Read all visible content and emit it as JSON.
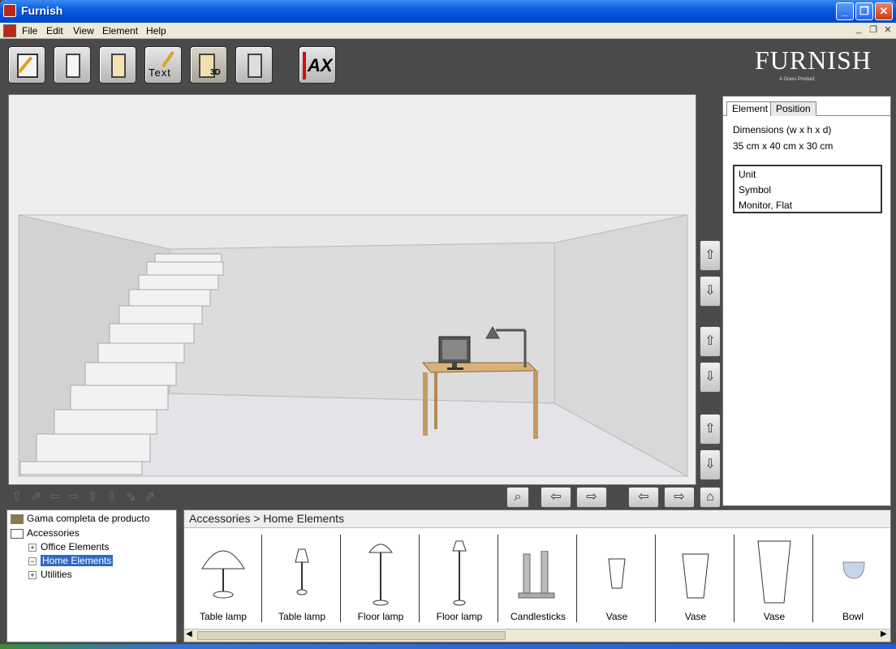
{
  "window": {
    "title": "Furnish"
  },
  "menu": {
    "items": [
      "File",
      "Edit",
      "View",
      "Element",
      "Help"
    ]
  },
  "toolbar": {
    "buttons": [
      {
        "name": "draw-tool",
        "label": ""
      },
      {
        "name": "door-tool",
        "label": ""
      },
      {
        "name": "window-tool",
        "label": ""
      },
      {
        "name": "text-tool",
        "label": "Text"
      },
      {
        "name": "3d-view",
        "label": "3D"
      },
      {
        "name": "calculator",
        "label": ""
      },
      {
        "name": "ax-button",
        "label": "AX"
      }
    ]
  },
  "brand": {
    "logo": "FURNISH",
    "sub": "A Grass Product"
  },
  "properties": {
    "tabs": [
      "Element",
      "Position"
    ],
    "dimensions_label": "Dimensions (w x h x d)",
    "dimensions_value": "35 cm x 40 cm x 30 cm",
    "attributes": [
      "Unit",
      "Symbol",
      "Monitor, Flat"
    ]
  },
  "tree": {
    "root": "Gama completa de producto",
    "accessories": "Accessories",
    "children": [
      "Office Elements",
      "Home Elements",
      "Utilities"
    ]
  },
  "catalog": {
    "breadcrumb": "Accessories > Home Elements",
    "items": [
      "Table lamp",
      "Table lamp",
      "Floor lamp",
      "Floor lamp",
      "Candlesticks",
      "Vase",
      "Vase",
      "Vase",
      "Bowl"
    ]
  },
  "icons": {
    "rotate_up": "⇧",
    "rotate_down": "⇩",
    "move_up": "⇧",
    "move_down": "⇩",
    "zoom": "🔍",
    "left": "⇦",
    "right": "⇨",
    "home": "⌂"
  }
}
